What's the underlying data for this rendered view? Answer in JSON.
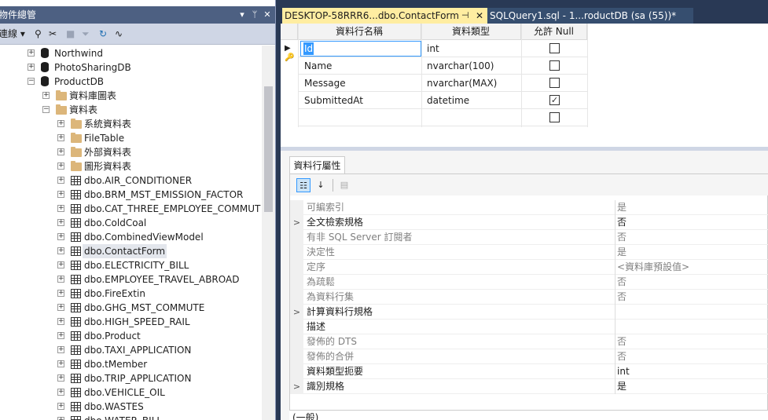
{
  "object_explorer": {
    "title": "物件總管",
    "connect_label": "連線",
    "tree": [
      {
        "label": "Northwind",
        "type": "database",
        "indent": 0,
        "expander": "+"
      },
      {
        "label": "PhotoSharingDB",
        "type": "database",
        "indent": 0,
        "expander": "+"
      },
      {
        "label": "ProductDB",
        "type": "database",
        "indent": 0,
        "expander": "−"
      },
      {
        "label": "資料庫圖表",
        "type": "folder",
        "indent": 1,
        "expander": "+"
      },
      {
        "label": "資料表",
        "type": "folder",
        "indent": 1,
        "expander": "−"
      },
      {
        "label": "系統資料表",
        "type": "folder",
        "indent": 2,
        "expander": "+"
      },
      {
        "label": "FileTable",
        "type": "folder",
        "indent": 2,
        "expander": "+"
      },
      {
        "label": "外部資料表",
        "type": "folder",
        "indent": 2,
        "expander": "+"
      },
      {
        "label": "圖形資料表",
        "type": "folder",
        "indent": 2,
        "expander": "+"
      },
      {
        "label": "dbo.AIR_CONDITIONER",
        "type": "table",
        "indent": 2,
        "expander": "+"
      },
      {
        "label": "dbo.BRM_MST_EMISSION_FACTOR",
        "type": "table",
        "indent": 2,
        "expander": "+"
      },
      {
        "label": "dbo.CAT_THREE_EMPLOYEE_COMMUT",
        "type": "table",
        "indent": 2,
        "expander": "+"
      },
      {
        "label": "dbo.ColdCoal",
        "type": "table",
        "indent": 2,
        "expander": "+"
      },
      {
        "label": "dbo.CombinedViewModel",
        "type": "table",
        "indent": 2,
        "expander": "+"
      },
      {
        "label": "dbo.ContactForm",
        "type": "table",
        "indent": 2,
        "expander": "+",
        "selected": true
      },
      {
        "label": "dbo.ELECTRICITY_BILL",
        "type": "table",
        "indent": 2,
        "expander": "+"
      },
      {
        "label": "dbo.EMPLOYEE_TRAVEL_ABROAD",
        "type": "table",
        "indent": 2,
        "expander": "+"
      },
      {
        "label": "dbo.FireExtin",
        "type": "table",
        "indent": 2,
        "expander": "+"
      },
      {
        "label": "dbo.GHG_MST_COMMUTE",
        "type": "table",
        "indent": 2,
        "expander": "+"
      },
      {
        "label": "dbo.HIGH_SPEED_RAIL",
        "type": "table",
        "indent": 2,
        "expander": "+"
      },
      {
        "label": "dbo.Product",
        "type": "table",
        "indent": 2,
        "expander": "+"
      },
      {
        "label": "dbo.TAXI_APPLICATION",
        "type": "table",
        "indent": 2,
        "expander": "+"
      },
      {
        "label": "dbo.tMember",
        "type": "table",
        "indent": 2,
        "expander": "+"
      },
      {
        "label": "dbo.TRIP_APPLICATION",
        "type": "table",
        "indent": 2,
        "expander": "+"
      },
      {
        "label": "dbo.VEHICLE_OIL",
        "type": "table",
        "indent": 2,
        "expander": "+"
      },
      {
        "label": "dbo.WASTES",
        "type": "table",
        "indent": 2,
        "expander": "+"
      },
      {
        "label": "dbo.WATER_BILL",
        "type": "table",
        "indent": 2,
        "expander": "+"
      }
    ]
  },
  "tabs": [
    {
      "label": "DESKTOP-58RRR6...dbo.ContactForm",
      "active": true
    },
    {
      "label": "SQLQuery1.sql - 1...roductDB (sa (55))*",
      "active": false
    }
  ],
  "table_designer": {
    "headers": [
      "資料行名稱",
      "資料類型",
      "允許 Null"
    ],
    "rows": [
      {
        "name": "Id",
        "type": "int",
        "allow_null": false
      },
      {
        "name": "Name",
        "type": "nvarchar(100)",
        "allow_null": false
      },
      {
        "name": "Message",
        "type": "nvarchar(MAX)",
        "allow_null": false
      },
      {
        "name": "SubmittedAt",
        "type": "datetime",
        "allow_null": true
      },
      {
        "name": "",
        "type": "",
        "allow_null": false
      }
    ]
  },
  "properties": {
    "tab_label": "資料行屬性",
    "rows": [
      {
        "name": "可編索引",
        "value": "是",
        "dim": true,
        "expander": ""
      },
      {
        "name": "全文檢索規格",
        "value": "否",
        "dim": false,
        "expander": ">"
      },
      {
        "name": "有非 SQL Server 訂閱者",
        "value": "否",
        "dim": true,
        "expander": ""
      },
      {
        "name": "決定性",
        "value": "是",
        "dim": true,
        "expander": ""
      },
      {
        "name": "定序",
        "value": "<資料庫預設值>",
        "dim": true,
        "expander": ""
      },
      {
        "name": "為疏鬆",
        "value": "否",
        "dim": true,
        "expander": ""
      },
      {
        "name": "為資料行集",
        "value": "否",
        "dim": true,
        "expander": ""
      },
      {
        "name": "計算資料行規格",
        "value": "",
        "dim": false,
        "expander": ">"
      },
      {
        "name": "描述",
        "value": "",
        "dim": false,
        "expander": ""
      },
      {
        "name": "發佈的 DTS",
        "value": "否",
        "dim": true,
        "expander": ""
      },
      {
        "name": "發佈的合併",
        "value": "否",
        "dim": true,
        "expander": ""
      },
      {
        "name": "資料類型扼要",
        "value": "int",
        "dim": false,
        "expander": ""
      },
      {
        "name": "識別規格",
        "value": "是",
        "dim": false,
        "expander": ">"
      }
    ],
    "footer": "(一般)"
  }
}
